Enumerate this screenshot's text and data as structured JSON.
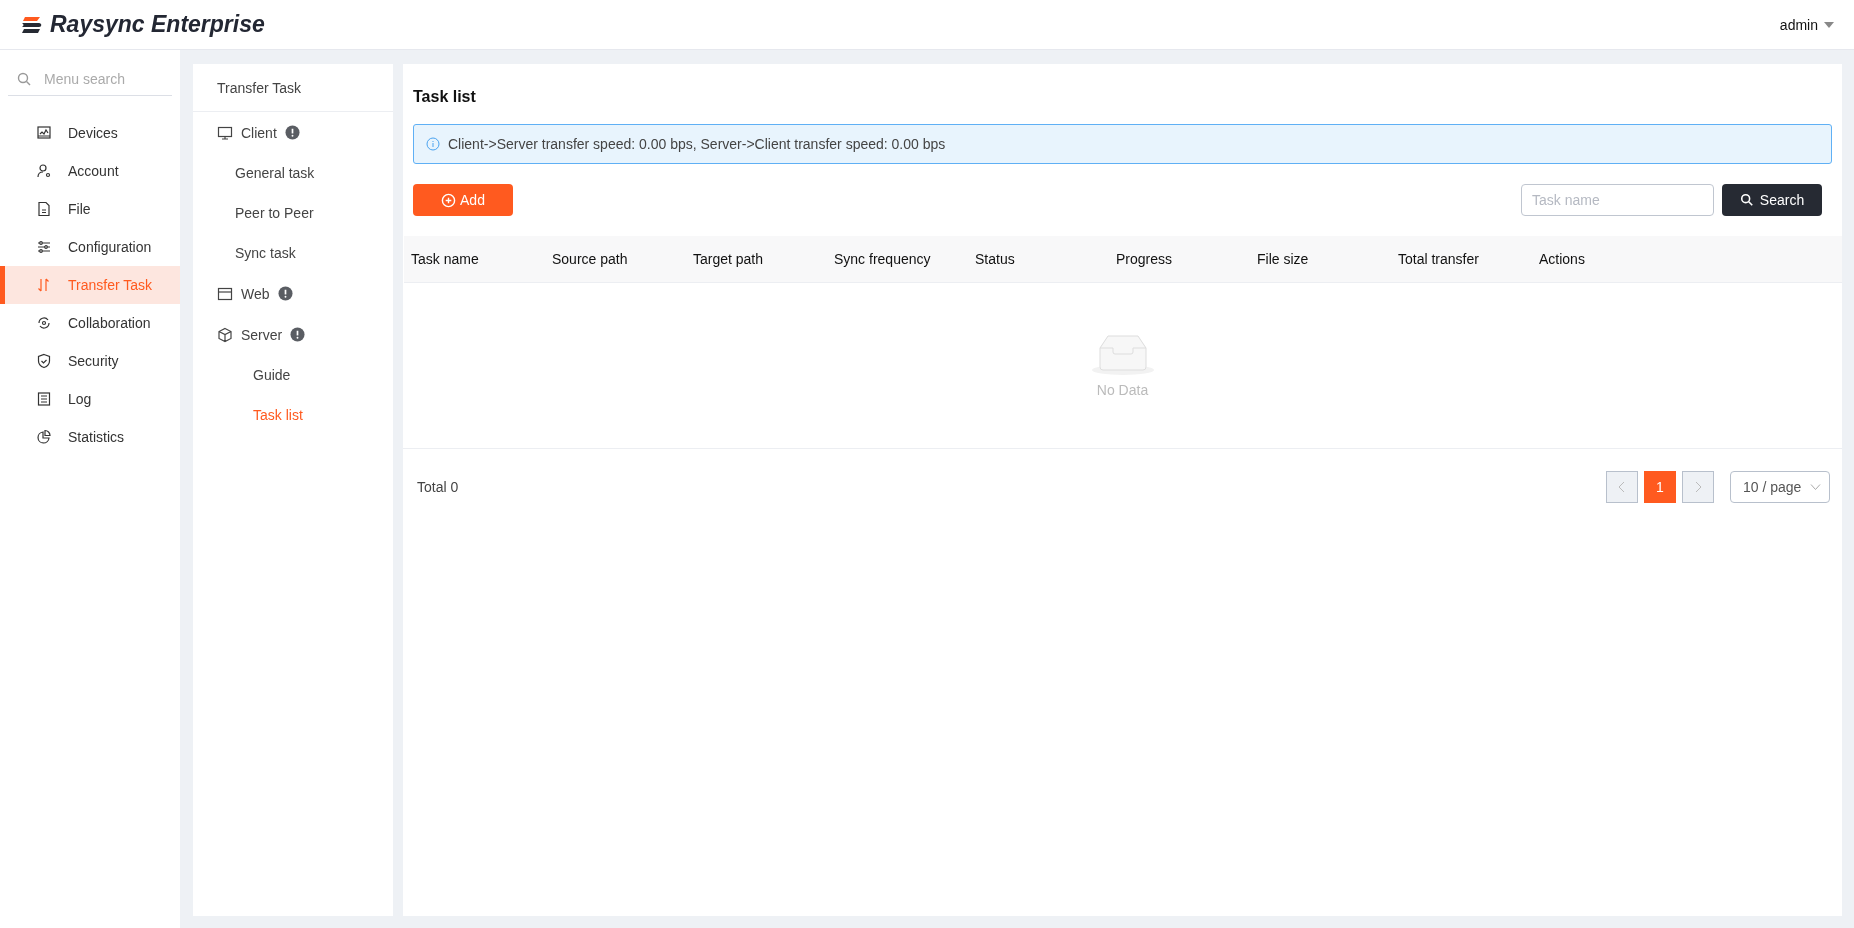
{
  "header": {
    "brand": "Raysync Enterprise",
    "user": "admin"
  },
  "sidebar": {
    "search_placeholder": "Menu search",
    "items": [
      {
        "label": "Devices",
        "selected": false
      },
      {
        "label": "Account",
        "selected": false
      },
      {
        "label": "File",
        "selected": false
      },
      {
        "label": "Configuration",
        "selected": false
      },
      {
        "label": "Transfer Task",
        "selected": true
      },
      {
        "label": "Collaboration",
        "selected": false
      },
      {
        "label": "Security",
        "selected": false
      },
      {
        "label": "Log",
        "selected": false
      },
      {
        "label": "Statistics",
        "selected": false
      }
    ]
  },
  "submenu": {
    "title": "Transfer Task",
    "groups": [
      {
        "label": "Client",
        "children": [
          {
            "label": "General task",
            "selected": false
          },
          {
            "label": "Peer to Peer",
            "selected": false
          },
          {
            "label": "Sync task",
            "selected": false
          }
        ]
      },
      {
        "label": "Web"
      },
      {
        "label": "Server",
        "children": [
          {
            "label": "Guide",
            "selected": false
          },
          {
            "label": "Task list",
            "selected": true
          }
        ]
      }
    ]
  },
  "main": {
    "title": "Task list",
    "alert": "Client->Server transfer speed: 0.00 bps, Server->Client transfer speed: 0.00 bps",
    "add_button": "Add",
    "search": {
      "placeholder": "Task name",
      "button": "Search"
    },
    "table": {
      "columns": [
        "Task name",
        "Source path",
        "Target path",
        "Sync frequency",
        "Status",
        "Progress",
        "File size",
        "Total transfer",
        "Actions"
      ],
      "empty_text": "No Data"
    },
    "footer": {
      "total": "Total 0",
      "pages": [
        {
          "label": "1",
          "selected": true
        }
      ],
      "page_size": "10 / page"
    }
  }
}
